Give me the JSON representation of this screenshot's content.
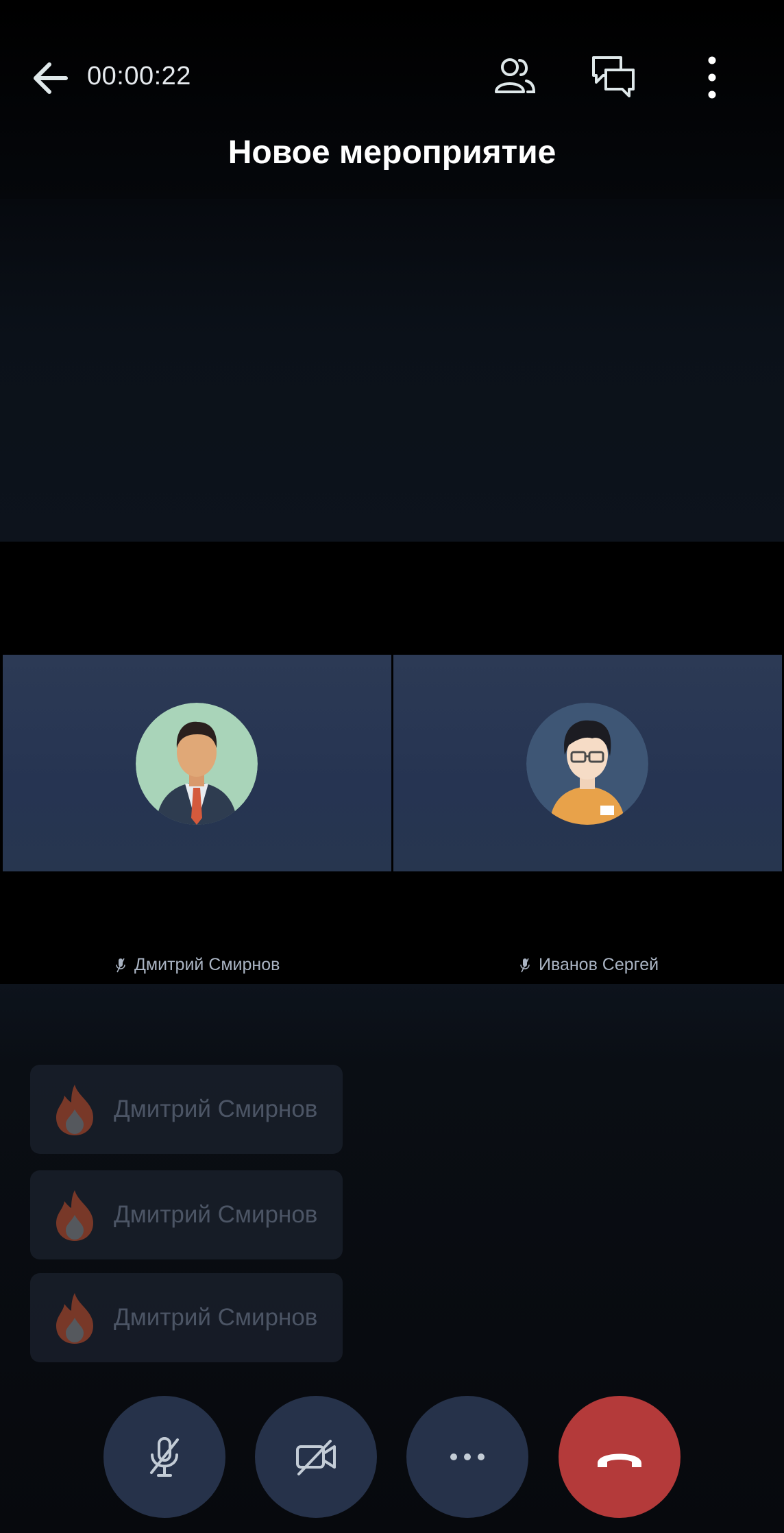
{
  "header": {
    "timer": "00:00:22",
    "title": "Новое мероприятие"
  },
  "participants": [
    {
      "name": "Дмитрий Смирнов",
      "avatar": "man-in-suit-avatar"
    },
    {
      "name": "Иванов Сергей",
      "avatar": "man-with-glasses-avatar"
    }
  ],
  "notifications": [
    {
      "name": "Дмитрий Смирнов",
      "icon": "fire-icon"
    },
    {
      "name": "Дмитрий Смирнов",
      "icon": "fire-icon"
    },
    {
      "name": "Дмитрий Смирнов",
      "icon": "fire-icon"
    }
  ],
  "controls": [
    "mic-muted-icon",
    "camera-off-icon",
    "more-icon",
    "hang-up-icon"
  ],
  "colors": {
    "end_call": "#b43a3a",
    "control_bg": "#26324a",
    "tile_bg": "#2a3853"
  }
}
